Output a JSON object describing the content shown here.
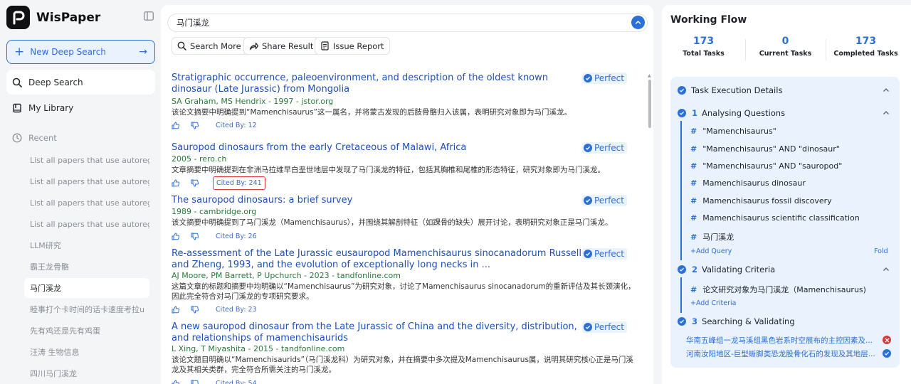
{
  "app": {
    "name": "WisPaper"
  },
  "sidebar": {
    "new_search": "New Deep Search",
    "nav": [
      {
        "label": "Deep Search",
        "icon": "search-icon"
      },
      {
        "label": "My Library",
        "icon": "book-icon"
      }
    ],
    "recent_label": "Recent",
    "recent": [
      "List all papers that use autoreg",
      "List all papers that use autoreg",
      "List all papers that use autoreg",
      "List all papers that use autoreg",
      "LLM研究",
      "霸王龙骨骼",
      "马门溪龙",
      "睦事打个卡时间的话卡速度考拉u",
      "先有鸡还是先有鸡蛋",
      "汪涛 生物信息",
      "四川马门溪龙"
    ],
    "active_recent_index": 6
  },
  "search": {
    "query": "马门溪龙",
    "actions": [
      "Search More",
      "Share Result",
      "Issue Report"
    ]
  },
  "results": [
    {
      "title": "Stratigraphic occurrence, paleoenvironment, and description of the oldest known dinosaur (Late Jurassic) from Mongolia",
      "meta": "SA Graham, MS Hendrix - 1997 - jstor.org",
      "snippet": "该论文摘要中明确提到“Mamenchisaurus”这一属名，并将蒙古发现的后肢骨骼归入该属，表明研究对象即为马门溪龙。",
      "badge": "Perfect",
      "cited": "Cited By: 12"
    },
    {
      "title": "Sauropod dinosaurs from the early Cretaceous of Malawi, Africa",
      "meta": "2005 - rero.ch",
      "snippet": "文章摘要中明确提到在非洲马拉维早白垩世地层中发现了马门溪龙的特征，包括其胸椎和尾椎的形态特征，研究对象即为马门溪龙。",
      "badge": "Perfect",
      "cited": "Cited By: 241"
    },
    {
      "title": "The sauropod dinosaurs: a brief survey",
      "meta": "1989 - cambridge.org",
      "snippet": "该文摘要中明确提到了马门溪龙（Mamenchisaurus），并围绕其解剖特征（如踝骨的缺失）展开讨论，表明研究对象正是马门溪龙。",
      "badge": "Perfect",
      "cited": "Cited By: 26"
    },
    {
      "title": "Re-assessment of the Late Jurassic eusauropod Mamenchisaurus sinocanadorum Russell and Zheng, 1993, and the evolution of exceptionally long necks in ...",
      "meta": "AJ Moore, PM Barrett, P Upchurch - 2023 - tandfonline.com",
      "snippet": "这篇文章的标题和摘要中均明确以“Mamenchisaurus”为研究对象，讨论了Mamenchisaurus sinocanadorum的重新评估及其长颈演化，因此完全符合对马门溪龙的专项研究要求。",
      "badge": "Perfect",
      "cited": "Cited By: 23"
    },
    {
      "title": "A new sauropod dinosaur from the Late Jurassic of China and the diversity, distribution, and relationships of mamenchisaurids",
      "meta": "L Xing, T Miyashita - 2015 - tandfonline.com",
      "snippet": "该论文题目明确以“Mamenchisaurids”（马门溪龙科）为研究对象，并在摘要中多次提及Mamenchisaurus属，说明其研究核心正是马门溪龙及其相关类群，完全符合所需关注的马门溪龙。",
      "badge": "Perfect",
      "cited": "Cited By: 54"
    }
  ],
  "workflow": {
    "title": "Working Flow",
    "stats": [
      {
        "value": "173",
        "label": "Total Tasks"
      },
      {
        "value": "0",
        "label": "Current Tasks"
      },
      {
        "value": "173",
        "label": "Completed Tasks"
      }
    ],
    "details_label": "Task Execution Details",
    "steps": [
      {
        "num": "1",
        "label": "Analysing Questions",
        "queries": [
          "\"Mamenchisaurus\"",
          "\"Mamenchisaurus\" AND \"dinosaur\"",
          "\"Mamenchisaurus\" AND \"sauropod\"",
          "Mamenchisaurus dinosaur",
          "Mamenchisaurus fossil discovery",
          "Mamenchisaurus scientific classification",
          "马门溪龙"
        ],
        "add": "+Add Query",
        "fold": "Fold"
      },
      {
        "num": "2",
        "label": "Validating Criteria",
        "queries": [
          "论文研究对象为马门溪龙（Mamenchisaurus)"
        ],
        "add": "+Add Criteria"
      },
      {
        "num": "3",
        "label": "Searching & Validating",
        "sources": [
          {
            "text": "华南五峰组一龙马溪组黑色岩系时空展布的主控因素及...",
            "status": "error"
          },
          {
            "text": "河南汝阳地区-巨型蜥脚类恐龙股骨化石的发现及其地层...",
            "status": "ok"
          }
        ]
      }
    ]
  },
  "colors": {
    "accent": "#2b6fd9",
    "link": "#1d4fb8",
    "meta": "#2a7a3a",
    "error": "#e0363b"
  }
}
